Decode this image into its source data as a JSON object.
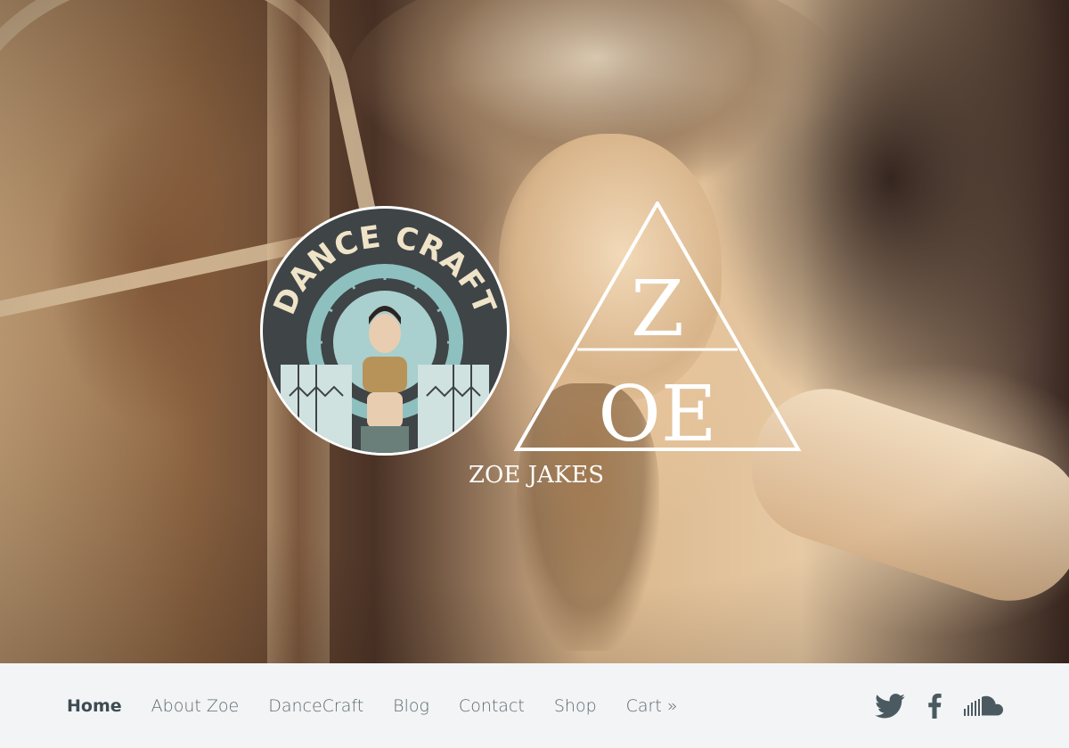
{
  "hero": {
    "badge": {
      "title": "DANCE CRAFT"
    },
    "logo": {
      "monogram_top": "Z",
      "monogram_bottom": "OE",
      "name": "ZOE JAKES"
    }
  },
  "nav": {
    "items": [
      {
        "label": "Home",
        "active": true
      },
      {
        "label": "About Zoe",
        "active": false
      },
      {
        "label": "DanceCraft",
        "active": false
      },
      {
        "label": "Blog",
        "active": false
      },
      {
        "label": "Contact",
        "active": false
      },
      {
        "label": "Shop",
        "active": false
      },
      {
        "label": "Cart »",
        "active": false
      }
    ],
    "social": [
      {
        "icon": "twitter-icon"
      },
      {
        "icon": "facebook-icon"
      },
      {
        "icon": "soundcloud-icon"
      }
    ]
  },
  "colors": {
    "nav_bg": "#f3f4f6",
    "nav_text": "#5b6a70",
    "nav_active": "#3d4c52",
    "badge_bg": "#3f4446",
    "badge_text": "#efe3c8",
    "badge_teal": "#7fb3b5"
  }
}
